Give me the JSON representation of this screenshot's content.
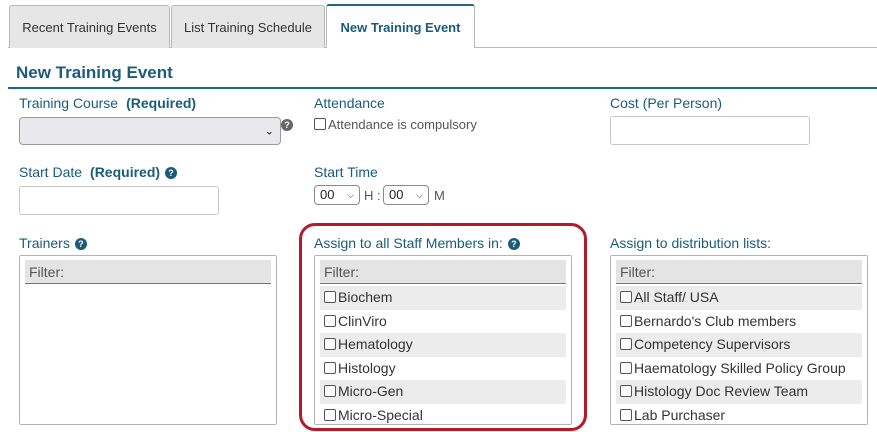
{
  "tabs": [
    {
      "label": "Recent Training Events"
    },
    {
      "label": "List Training Schedule"
    },
    {
      "label": "New Training Event"
    }
  ],
  "heading": "New Training Event",
  "training_course": {
    "label": "Training Course",
    "required": "(Required)",
    "value": ""
  },
  "attendance": {
    "label": "Attendance",
    "checkbox_label": "Attendance is compulsory",
    "checked": false
  },
  "cost": {
    "label": "Cost (Per Person)",
    "value": ""
  },
  "start_date": {
    "label": "Start Date",
    "required": "(Required)",
    "value": ""
  },
  "start_time": {
    "label": "Start Time",
    "hour": "00",
    "hour_unit": "H :",
    "minute": "00",
    "minute_unit": "M"
  },
  "trainers": {
    "label": "Trainers",
    "filter": "Filter:"
  },
  "staff": {
    "label": "Assign to all Staff Members in:",
    "filter": "Filter:",
    "items": [
      "Biochem",
      "ClinViro",
      "Hematology",
      "Histology",
      "Micro-Gen",
      "Micro-Special"
    ]
  },
  "distribution": {
    "label": "Assign to distribution lists:",
    "filter": "Filter:",
    "items": [
      "All Staff/ USA",
      "Bernardo's Club members",
      "Competency Supervisors",
      "Haematology Skilled Policy Group",
      "Histology Doc Review Team",
      "Lab Purchaser"
    ]
  },
  "colors": {
    "accent": "#1a5c7a",
    "highlight": "#b41b28"
  },
  "icons": {
    "help": "question-circle-icon",
    "dropdown": "chevron-down-icon"
  }
}
